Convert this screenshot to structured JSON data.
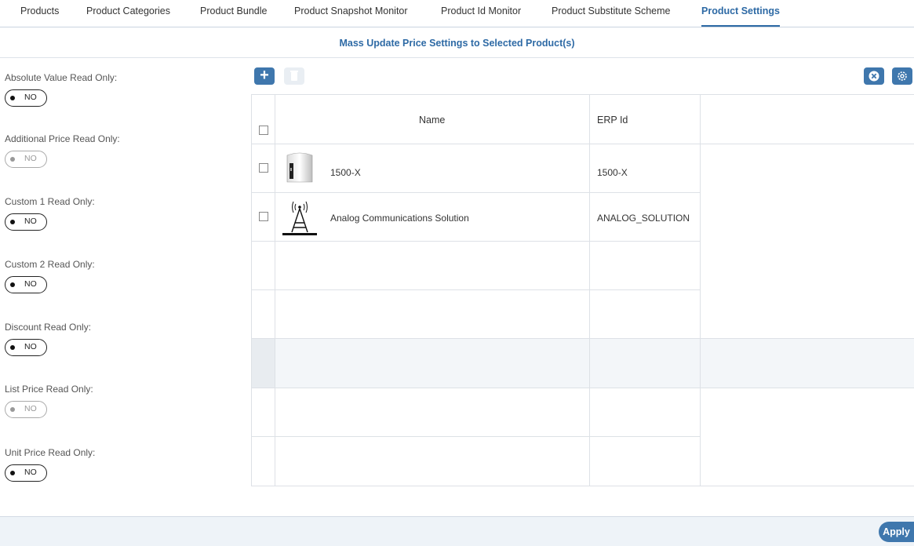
{
  "nav": {
    "tabs": [
      {
        "label": "Products"
      },
      {
        "label": "Product Categories"
      },
      {
        "label": "Product Bundle"
      },
      {
        "label": "Product Snapshot Monitor"
      },
      {
        "label": "Product Id Monitor"
      },
      {
        "label": "Product Substitute Scheme"
      },
      {
        "label": "Product Settings"
      }
    ],
    "active": "Product Settings"
  },
  "subtitle": "Mass Update Price Settings to Selected Product(s)",
  "settings": [
    {
      "label": "Absolute Value Read Only:",
      "value": "NO",
      "enabled": true
    },
    {
      "label": "Additional Price Read Only:",
      "value": "NO",
      "enabled": false
    },
    {
      "label": "Custom 1 Read Only:",
      "value": "NO",
      "enabled": true
    },
    {
      "label": "Custom 2 Read Only:",
      "value": "NO",
      "enabled": true
    },
    {
      "label": "Discount Read Only:",
      "value": "NO",
      "enabled": true
    },
    {
      "label": "List Price Read Only:",
      "value": "NO",
      "enabled": false
    },
    {
      "label": "Unit Price Read Only:",
      "value": "NO",
      "enabled": true
    }
  ],
  "toolbar": {
    "add_icon": "plus-icon",
    "delete_icon": "trash-icon",
    "close_icon": "close-circle-icon",
    "settings_icon": "gear-icon"
  },
  "table": {
    "columns": [
      "Name",
      "ERP Id"
    ],
    "rows": [
      {
        "name": "1500-X",
        "erp_id": "1500-X",
        "thumbnail": "device-image"
      },
      {
        "name": "Analog Communications Solution",
        "erp_id": "ANALOG_SOLUTION",
        "thumbnail": "antenna-tower-image"
      }
    ]
  },
  "footer": {
    "apply_label": "Apply"
  },
  "colors": {
    "accent": "#3f77ad",
    "title": "#2e6aa5",
    "footer_bg": "#eef3f8"
  }
}
